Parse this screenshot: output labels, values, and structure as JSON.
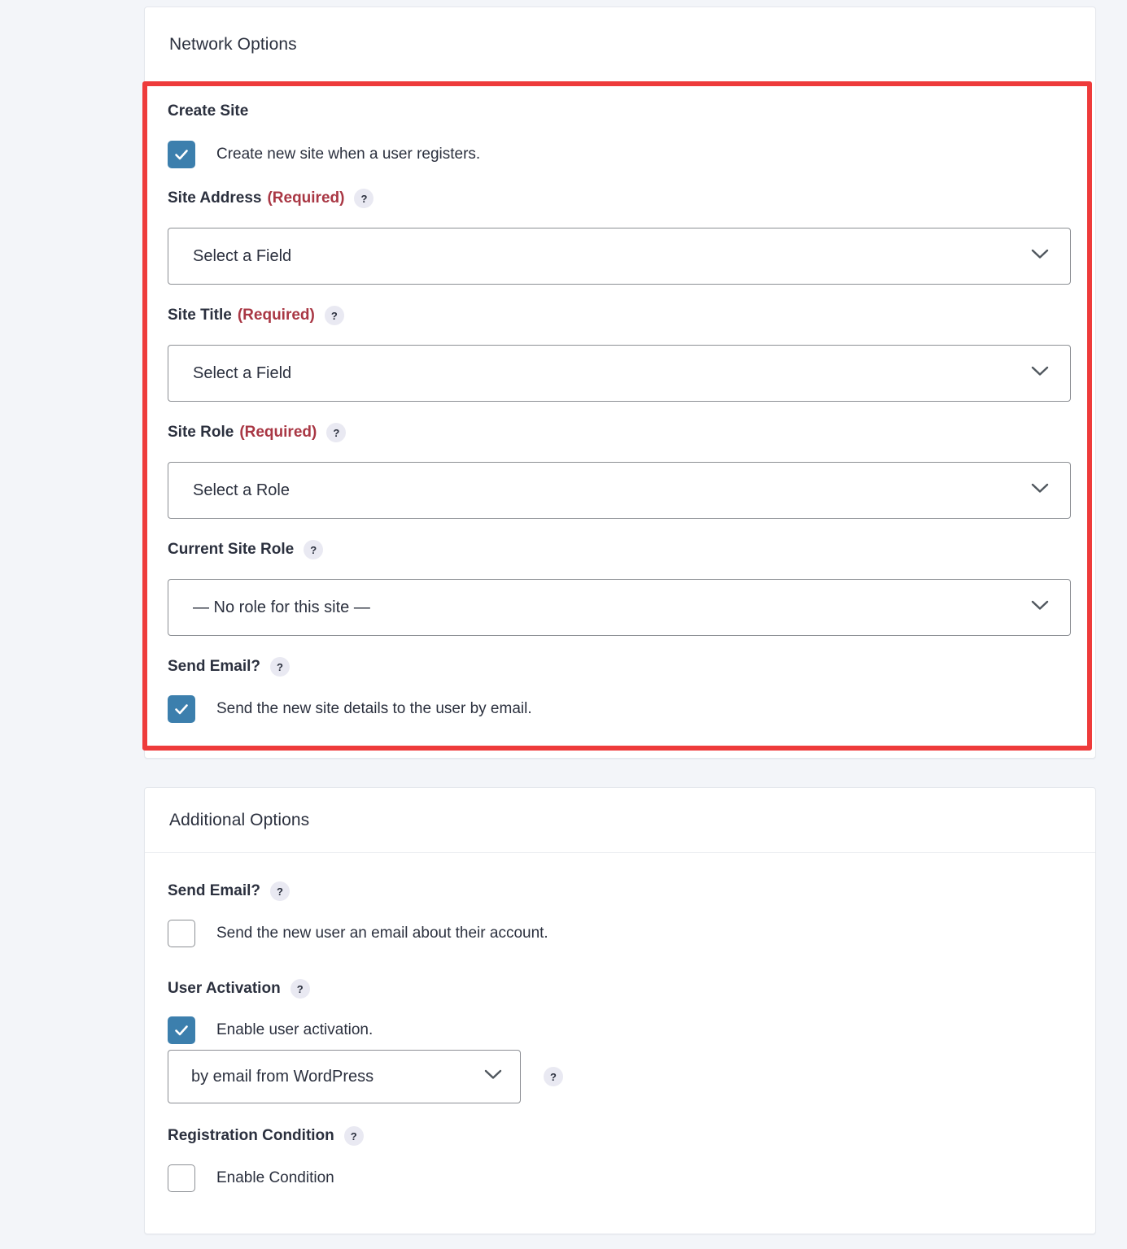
{
  "network_panel": {
    "title": "Network Options",
    "create_site": {
      "label": "Create Site",
      "checkbox_label": "Create new site when a user registers.",
      "checked": true
    },
    "site_address": {
      "label": "Site Address",
      "required_text": "(Required)",
      "help": "?",
      "value": "Select a Field"
    },
    "site_title": {
      "label": "Site Title",
      "required_text": "(Required)",
      "help": "?",
      "value": "Select a Field"
    },
    "site_role": {
      "label": "Site Role",
      "required_text": "(Required)",
      "help": "?",
      "value": "Select a Role"
    },
    "current_site_role": {
      "label": "Current Site Role",
      "help": "?",
      "value": "— No role for this site —"
    },
    "send_email": {
      "label": "Send Email?",
      "help": "?",
      "checkbox_label": "Send the new site details to the user by email.",
      "checked": true
    }
  },
  "additional_panel": {
    "title": "Additional Options",
    "send_email": {
      "label": "Send Email?",
      "help": "?",
      "checkbox_label": "Send the new user an email about their account.",
      "checked": false
    },
    "user_activation": {
      "label": "User Activation",
      "help": "?",
      "checkbox_label": "Enable user activation.",
      "checked": true,
      "method_value": "by email from WordPress",
      "method_help": "?"
    },
    "registration_condition": {
      "label": "Registration Condition",
      "help": "?",
      "checkbox_label": "Enable Condition",
      "checked": false
    }
  },
  "colors": {
    "accent_checkbox": "#3c7fad",
    "highlight_border": "#ee3b3b",
    "required_text": "#a93744",
    "text": "#2b303e",
    "page_background": "#f3f5f9"
  }
}
